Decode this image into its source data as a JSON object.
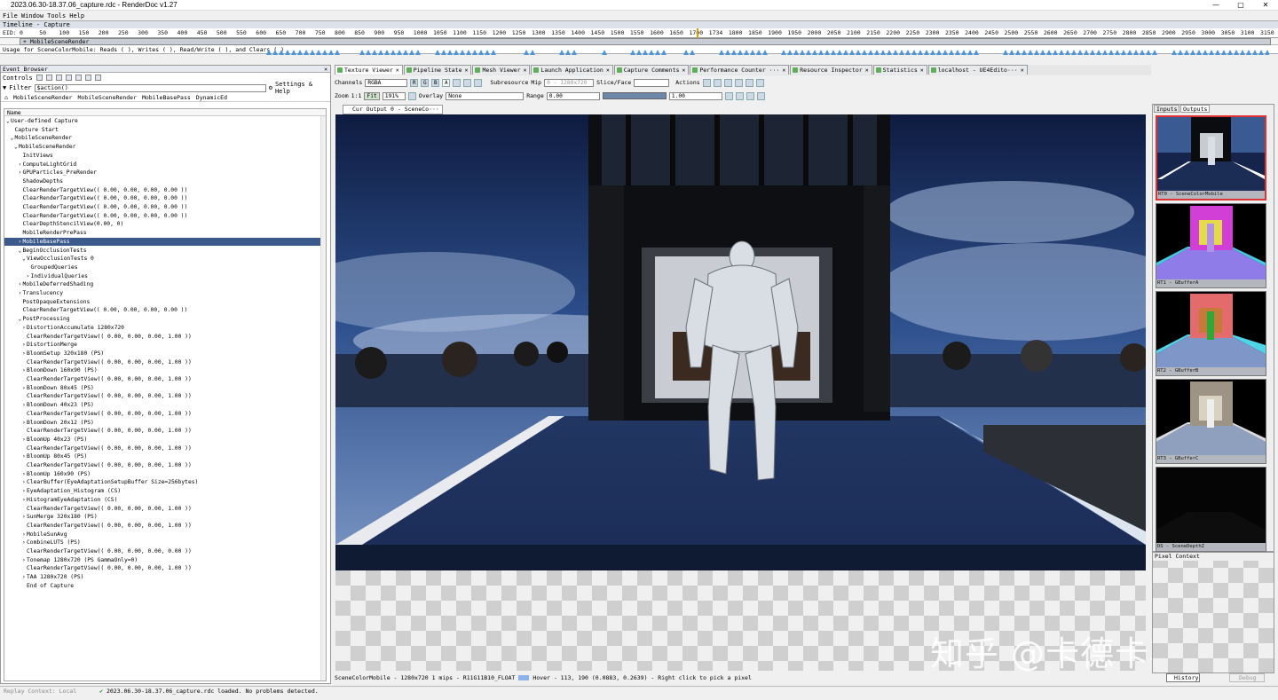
{
  "window": {
    "title": "2023.06.30-18.37.06_capture.rdc - RenderDoc v1.27",
    "min": "—",
    "max": "▢",
    "close": "✕"
  },
  "menu": [
    "File",
    "Window",
    "Tools",
    "Help"
  ],
  "timeline": {
    "header": "Timeline - Capture",
    "eid_label": "EID:",
    "ticks": [
      "0",
      "50",
      "100",
      "150",
      "200",
      "250",
      "300",
      "350",
      "400",
      "450",
      "500",
      "550",
      "600",
      "650",
      "700",
      "750",
      "800",
      "850",
      "900",
      "950",
      "1000",
      "1050",
      "1100",
      "1150",
      "1200",
      "1250",
      "1300",
      "1350",
      "1400",
      "1450",
      "1500",
      "1550",
      "1600",
      "1650",
      "1700",
      "1734",
      "1800",
      "1850",
      "1900",
      "1950",
      "2000",
      "2050",
      "2100",
      "2150",
      "2200",
      "2250",
      "2300",
      "2350",
      "2400",
      "2450",
      "2500",
      "2550",
      "2600",
      "2650",
      "2700",
      "2750",
      "2800",
      "2850",
      "2900",
      "2950",
      "3000",
      "3050",
      "3100",
      "3150"
    ],
    "section": "+ MobileSceneRender",
    "usage": "Usage for SceneColorMobile: Reads ( ), Writes ( ), Read/Write ( ), and Clears ( )"
  },
  "event_browser": {
    "title": "Event Browser",
    "controls_label": "Controls",
    "filter_label": "Filter",
    "filter_value": "$action()",
    "settings_label": "Settings & Help",
    "breadcrumbs": [
      "MobileSceneRender",
      "MobileSceneRender",
      "MobileBasePass",
      "DynamicEd"
    ],
    "column": "Name",
    "rows": [
      {
        "indent": 0,
        "arrow": "⌄",
        "text": "User-defined Capture"
      },
      {
        "indent": 1,
        "arrow": "",
        "text": "Capture Start"
      },
      {
        "indent": 1,
        "arrow": "⌄",
        "text": "MobileSceneRender"
      },
      {
        "indent": 2,
        "arrow": "⌄",
        "text": "MobileSceneRender"
      },
      {
        "indent": 3,
        "arrow": "",
        "text": "InitViews"
      },
      {
        "indent": 3,
        "arrow": "›",
        "text": "ComputeLightGrid"
      },
      {
        "indent": 3,
        "arrow": "›",
        "text": "GPUParticles_PreRender"
      },
      {
        "indent": 3,
        "arrow": "",
        "text": "ShadowDepths"
      },
      {
        "indent": 3,
        "arrow": "",
        "text": "ClearRenderTargetView(( 0.00, 0.00, 0.00, 0.00 ))"
      },
      {
        "indent": 3,
        "arrow": "",
        "text": "ClearRenderTargetView(( 0.00, 0.00, 0.00, 0.00 ))"
      },
      {
        "indent": 3,
        "arrow": "",
        "text": "ClearRenderTargetView(( 0.00, 0.00, 0.00, 0.00 ))"
      },
      {
        "indent": 3,
        "arrow": "",
        "text": "ClearRenderTargetView(( 0.00, 0.00, 0.00, 0.00 ))"
      },
      {
        "indent": 3,
        "arrow": "",
        "text": "ClearDepthStencilView(0.00, 0)"
      },
      {
        "indent": 3,
        "arrow": "",
        "text": "MobileRenderPrePass"
      },
      {
        "indent": 3,
        "arrow": "›",
        "text": "MobileBasePass",
        "selected": true
      },
      {
        "indent": 3,
        "arrow": "⌄",
        "text": "BeginOcclusionTests"
      },
      {
        "indent": 4,
        "arrow": "⌄",
        "text": "ViewOcclusionTests 0"
      },
      {
        "indent": 5,
        "arrow": "",
        "text": "GroupedQueries"
      },
      {
        "indent": 5,
        "arrow": "›",
        "text": "IndividualQueries"
      },
      {
        "indent": 3,
        "arrow": "›",
        "text": "MobileDeferredShading"
      },
      {
        "indent": 3,
        "arrow": "›",
        "text": "Translucency"
      },
      {
        "indent": 3,
        "arrow": "",
        "text": "PostOpaqueExtensions"
      },
      {
        "indent": 3,
        "arrow": "",
        "text": "ClearRenderTargetView(( 0.00, 0.00, 0.00, 0.00 ))"
      },
      {
        "indent": 3,
        "arrow": "⌄",
        "text": "PostProcessing"
      },
      {
        "indent": 4,
        "arrow": "›",
        "text": "DistortionAccumulate 1280x720"
      },
      {
        "indent": 4,
        "arrow": "",
        "text": "ClearRenderTargetView(( 0.00, 0.00, 0.00, 1.00 ))"
      },
      {
        "indent": 4,
        "arrow": "›",
        "text": "DistortionMerge"
      },
      {
        "indent": 4,
        "arrow": "›",
        "text": "BloomSetup 320x180 (PS)"
      },
      {
        "indent": 4,
        "arrow": "",
        "text": "ClearRenderTargetView(( 0.00, 0.00, 0.00, 1.00 ))"
      },
      {
        "indent": 4,
        "arrow": "›",
        "text": "BloomDown 160x90 (PS)"
      },
      {
        "indent": 4,
        "arrow": "",
        "text": "ClearRenderTargetView(( 0.00, 0.00, 0.00, 1.00 ))"
      },
      {
        "indent": 4,
        "arrow": "›",
        "text": "BloomDown 80x45 (PS)"
      },
      {
        "indent": 4,
        "arrow": "",
        "text": "ClearRenderTargetView(( 0.00, 0.00, 0.00, 1.00 ))"
      },
      {
        "indent": 4,
        "arrow": "›",
        "text": "BloomDown 40x23 (PS)"
      },
      {
        "indent": 4,
        "arrow": "",
        "text": "ClearRenderTargetView(( 0.00, 0.00, 0.00, 1.00 ))"
      },
      {
        "indent": 4,
        "arrow": "›",
        "text": "BloomDown 20x12 (PS)"
      },
      {
        "indent": 4,
        "arrow": "",
        "text": "ClearRenderTargetView(( 0.00, 0.00, 0.00, 1.00 ))"
      },
      {
        "indent": 4,
        "arrow": "›",
        "text": "BloomUp 40x23 (PS)"
      },
      {
        "indent": 4,
        "arrow": "",
        "text": "ClearRenderTargetView(( 0.00, 0.00, 0.00, 1.00 ))"
      },
      {
        "indent": 4,
        "arrow": "›",
        "text": "BloomUp 80x45 (PS)"
      },
      {
        "indent": 4,
        "arrow": "",
        "text": "ClearRenderTargetView(( 0.00, 0.00, 0.00, 1.00 ))"
      },
      {
        "indent": 4,
        "arrow": "›",
        "text": "BloomUp 160x90 (PS)"
      },
      {
        "indent": 4,
        "arrow": "›",
        "text": "ClearBuffer(EyeAdaptationSetupBuffer Size=256bytes)"
      },
      {
        "indent": 4,
        "arrow": "›",
        "text": "EyeAdaptation_Histogram (CS)"
      },
      {
        "indent": 4,
        "arrow": "›",
        "text": "HistogramEyeAdaptation (CS)"
      },
      {
        "indent": 4,
        "arrow": "",
        "text": "ClearRenderTargetView(( 0.00, 0.00, 0.00, 1.00 ))"
      },
      {
        "indent": 4,
        "arrow": "›",
        "text": "SunMerge 320x180 (PS)"
      },
      {
        "indent": 4,
        "arrow": "",
        "text": "ClearRenderTargetView(( 0.00, 0.00, 0.00, 1.00 ))"
      },
      {
        "indent": 4,
        "arrow": "›",
        "text": "MobileSunAvg"
      },
      {
        "indent": 4,
        "arrow": "›",
        "text": "CombineLUTS (PS)"
      },
      {
        "indent": 4,
        "arrow": "",
        "text": "ClearRenderTargetView(( 0.00, 0.00, 0.00, 0.00 ))"
      },
      {
        "indent": 4,
        "arrow": "›",
        "text": "Tonemap 1280x720 (PS GammaOnly=0)"
      },
      {
        "indent": 4,
        "arrow": "",
        "text": "ClearRenderTargetView(( 0.00, 0.00, 0.00, 1.00 ))"
      },
      {
        "indent": 4,
        "arrow": "›",
        "text": "TAA 1280x720 (PS)"
      },
      {
        "indent": 4,
        "arrow": "",
        "text": "End of Capture"
      }
    ]
  },
  "tabs": [
    "Texture Viewer",
    "Pipeline State",
    "Mesh Viewer",
    "Launch Application",
    "Capture Comments",
    "Performance Counter ···",
    "Resource Inspector",
    "Statistics",
    "localhost - UE4Edito···"
  ],
  "texture_viewer": {
    "channels_label": "Channels",
    "channels_value": "RGBA",
    "channel_buttons": [
      "R",
      "G",
      "B",
      "A"
    ],
    "subresource_label": "Subresource",
    "mip_label": "Mip",
    "mip_value": "0 - 1280x720",
    "slice_label": "Slice/Face",
    "actions_label": "Actions",
    "zoom_label": "Zoom",
    "zoom_1to1": "1:1",
    "fit_label": "Fit",
    "zoom_value": "191%",
    "overlay_label": "Overlay",
    "overlay_value": "None",
    "range_label": "Range",
    "range_min": "0.00",
    "range_max": "1.00",
    "output_tab": "Cur Output 0 - SceneCo···",
    "status": "SceneColorMobile - 1280x720 1 mips - R11G11B10_FLOAT",
    "hover": "Hover -    113,  190 (0.0883, 0.2639)  - Right click to pick a pixel"
  },
  "thumbnails": {
    "tabs": [
      "Inputs",
      "Outputs"
    ],
    "items": [
      {
        "label": "RT0 - SceneColorMobile"
      },
      {
        "label": "RT1 - GBufferA"
      },
      {
        "label": "RT2 - GBufferB"
      },
      {
        "label": "RT3 - GBufferC"
      },
      {
        "label": "DS - SceneDepthZ"
      }
    ]
  },
  "pixel_context": {
    "title": "Pixel Context",
    "history": "History",
    "debug": "Debug"
  },
  "statusbar": {
    "replay": "Replay Context: Local",
    "message": "2023.06.30-18.37.06_capture.rdc loaded. No problems detected."
  },
  "watermark": "知乎 @卡德卡斯基"
}
